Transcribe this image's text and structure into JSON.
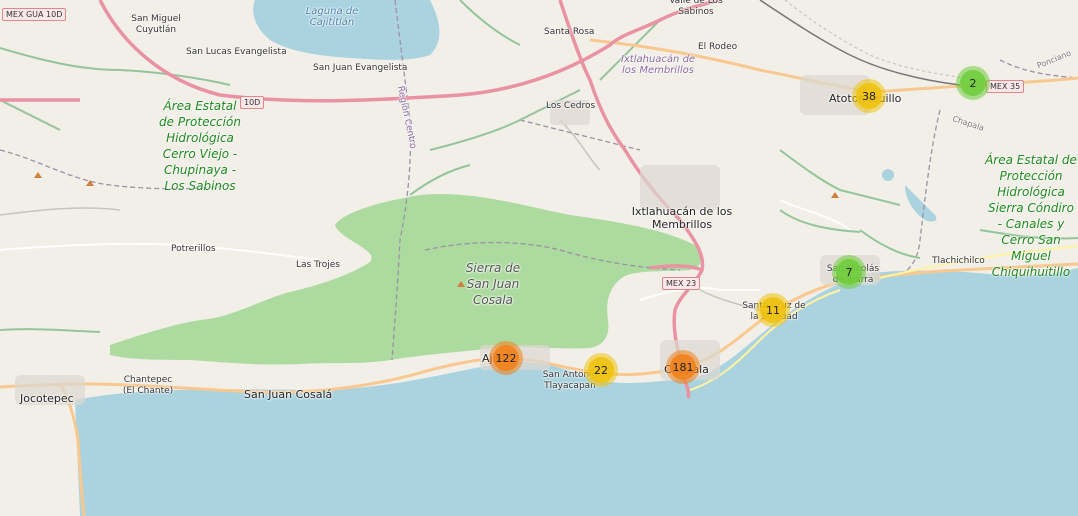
{
  "map": {
    "colors": {
      "water": "#aad3df",
      "land": "#f2efe9",
      "park": "#addb9f",
      "park_label": "#1f8a1f",
      "primary_road": "#e892a2",
      "secondary_road": "#f9c88f",
      "boundary": "#9e8fa8",
      "cluster_small": "#6ecc39",
      "cluster_medium": "#f0c20c",
      "cluster_large": "#f18017"
    },
    "clusters": [
      {
        "count": "38",
        "size": "medium"
      },
      {
        "count": "2",
        "size": "small"
      },
      {
        "count": "7",
        "size": "small"
      },
      {
        "count": "11",
        "size": "medium"
      },
      {
        "count": "122",
        "size": "large"
      },
      {
        "count": "22",
        "size": "medium"
      },
      {
        "count": "181",
        "size": "large"
      }
    ],
    "places": {
      "san_miguel_cuyutlan": "San Miguel Cuyutlán",
      "laguna_cajititlan": "Laguna de Cajititlán",
      "valle_sabinos": "Valle de Los Sabinos",
      "san_lucas": "San Lucas Evangelista",
      "san_juan_evangelista": "San Juan Evangelista",
      "santa_rosa": "Santa Rosa",
      "el_rodeo": "El Rodeo",
      "ixtlahuacan_muni": "Ixtlahuacán de los Membrillos",
      "atotonilquillo": "Atotonilquillo",
      "los_cedros": "Los Cedros",
      "region_centro": "Región Centro",
      "ponciano": "Ponciano",
      "chapala_road": "Chapala",
      "ixtlahuacan": "Ixtlahuacán de los Membrillos",
      "potrerillos": "Potrerillos",
      "las_trojes": "Las Trojes",
      "sierra": "Sierra de San Juan Cosala",
      "san_nicolas": "San Nicolás de Ibarra",
      "tlachichilco": "Tlachichilco",
      "santa_cruz": "Santa Cruz de la Soledad",
      "ajijic": "Ajijic",
      "san_antonio": "San Antonio Tlayacapan",
      "chapala": "Chapala",
      "chantepec": "Chantepec (El Chante)",
      "jocotepec": "Jocotepec",
      "san_juan_cosala": "San Juan Cosalá"
    },
    "parks": {
      "cerro_viejo": "Área Estatal de Protección Hidrológica Cerro Viejo - Chupinaya - Los Sabinos",
      "sierra_condiro": "Área Estatal de Protección Hidrológica Sierra Cóndiro - Canales y Cerro San Miguel Chiquihuitillo"
    },
    "shields": {
      "mex_gua_10d": "MEX GUA 10D",
      "r10d": "10D",
      "mex_35": "MEX 35",
      "mex_23": "MEX 23"
    }
  }
}
